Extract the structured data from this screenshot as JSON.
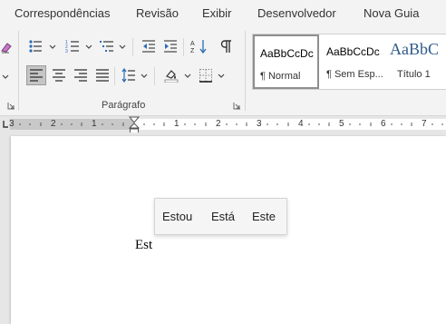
{
  "ribbon_tabs": [
    "Correspondências",
    "Revisão",
    "Exibir",
    "Desenvolvedor",
    "Nova Guia"
  ],
  "paragraph_group": {
    "label": "Parágrafo"
  },
  "styles": [
    {
      "sample": "AaBbCcDc",
      "name": "¶ Normal"
    },
    {
      "sample": "AaBbCcDc",
      "name": "¶ Sem Esp..."
    },
    {
      "sample": "AaBbC",
      "name": "Título 1"
    }
  ],
  "ruler": {
    "numbers": [
      "3",
      "2",
      "1",
      "1",
      "2",
      "3",
      "4",
      "5",
      "6",
      "7"
    ]
  },
  "document": {
    "text": "Est"
  },
  "autocomplete": {
    "suggestions": [
      "Estou",
      "Está",
      "Este"
    ]
  },
  "colors": {
    "ribbon_bg": "#f3f3f3",
    "page_bg": "#ffffff",
    "heading_blue": "#2e5a8c",
    "selected_border": "#8f8f8f"
  },
  "icons": [
    "eraser-icon",
    "bullets-icon",
    "numbering-icon",
    "multilevel-list-icon",
    "decrease-indent-icon",
    "increase-indent-icon",
    "sort-icon",
    "pilcrow-icon",
    "align-left-icon",
    "align-center-icon",
    "align-right-icon",
    "justify-icon",
    "line-spacing-icon",
    "shading-icon",
    "borders-icon",
    "dialog-launcher-icon",
    "tab-stop-icon",
    "indent-marker-icon"
  ]
}
